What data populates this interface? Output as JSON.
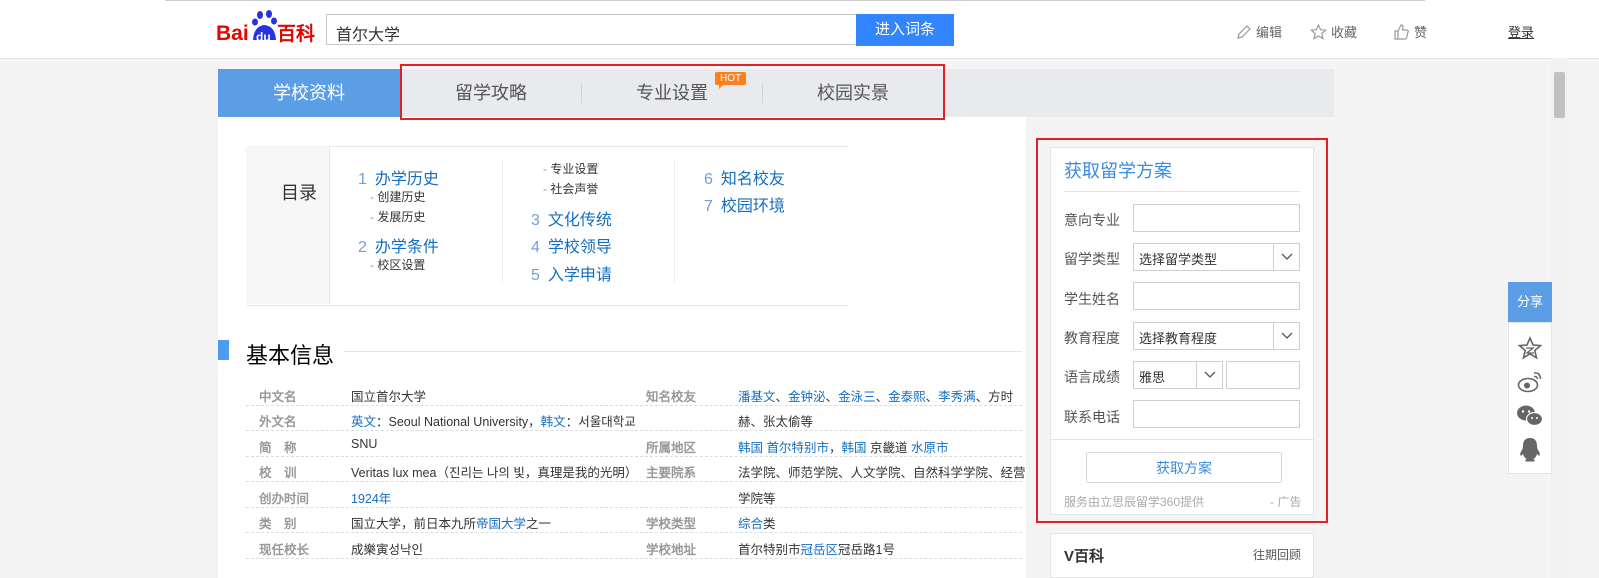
{
  "header": {
    "logo_text_bai": "Bai",
    "logo_text_du": "du",
    "logo_text_baike": "百科",
    "search_value": "首尔大学",
    "search_button": "进入词条",
    "edit_label": "编辑",
    "favorite_label": "收藏",
    "like_label": "赞",
    "login_label": "登录"
  },
  "tabs": [
    {
      "label": "学校资料"
    },
    {
      "label": "留学攻略"
    },
    {
      "label": "专业设置",
      "badge": "HOT"
    },
    {
      "label": "校园实景"
    }
  ],
  "catalog": {
    "title": "目录",
    "col1": [
      {
        "num": "1",
        "label": "办学历史"
      },
      {
        "sub": "创建历史"
      },
      {
        "sub": "发展历史"
      },
      {
        "num": "2",
        "label": "办学条件"
      },
      {
        "sub": "校区设置"
      }
    ],
    "col2": [
      {
        "sub": "专业设置"
      },
      {
        "sub": "社会声誉"
      },
      {
        "num": "3",
        "label": "文化传统"
      },
      {
        "num": "4",
        "label": "学校领导"
      },
      {
        "num": "5",
        "label": "入学申请"
      }
    ],
    "col3": [
      {
        "num": "6",
        "label": "知名校友"
      },
      {
        "num": "7",
        "label": "校园环境"
      }
    ]
  },
  "basic_info": {
    "title": "基本信息",
    "left": [
      {
        "label": "中文名",
        "value": "国立首尔大学"
      },
      {
        "label": "外文名",
        "link1": "英文",
        "text1": "：Seoul National University，",
        "link2": "韩文",
        "text2": "：서울대학교"
      },
      {
        "label": "简　称",
        "value": "SNU"
      },
      {
        "label": "校　训",
        "value": "Veritas lux mea（진리는 나의 빛，真理是我的光明）"
      },
      {
        "label": "创办时间",
        "link": "1924年"
      },
      {
        "label": "类　别",
        "text1": "国立大学，前日本九所",
        "link": "帝国大学",
        "text2": "之一"
      },
      {
        "label": "现任校长",
        "value": "成樂寅성낙인"
      }
    ],
    "right": [
      {
        "label": "知名校友",
        "links": [
          "潘基文",
          "金钟泌",
          "金泳三",
          "金泰熙",
          "李秀满"
        ],
        "suffix": "、方时"
      },
      {
        "label": "",
        "value": "赫、张太偷等"
      },
      {
        "label": "所属地区",
        "link1": "韩国 首尔特别市",
        "text1": "，",
        "link2": "韩国",
        "text2": " 京畿道 ",
        "link3": "水原市"
      },
      {
        "label": "主要院系",
        "value": "法学院、师范学院、人文学院、自然科学学院、经营"
      },
      {
        "label": "",
        "value": "学院等"
      },
      {
        "label": "学校类型",
        "link": "综合",
        "text": "类"
      },
      {
        "label": "学校地址",
        "text1": "首尔特别市",
        "link": "冠岳区",
        "text2": "冠岳路1号"
      }
    ]
  },
  "form": {
    "title": "获取留学方案",
    "fields": [
      {
        "label": "意向专业"
      },
      {
        "label": "留学类型",
        "select": "选择留学类型"
      },
      {
        "label": "学生姓名"
      },
      {
        "label": "教育程度",
        "select": "选择教育程度"
      },
      {
        "label": "语言成绩",
        "select": "雅思"
      },
      {
        "label": "联系电话"
      }
    ],
    "submit": "获取方案",
    "provider": "服务由立思辰留学360提供",
    "ad": "- 广告"
  },
  "vbaike": {
    "title": "V百科",
    "more": "往期回顾"
  },
  "share": {
    "label": "分享"
  },
  "colors": {
    "accent": "#5b9ee6",
    "link": "#136ec2",
    "search_button": "#3385ff",
    "highlight_box": "#e32026",
    "hot_badge": "#ff7f1e"
  }
}
